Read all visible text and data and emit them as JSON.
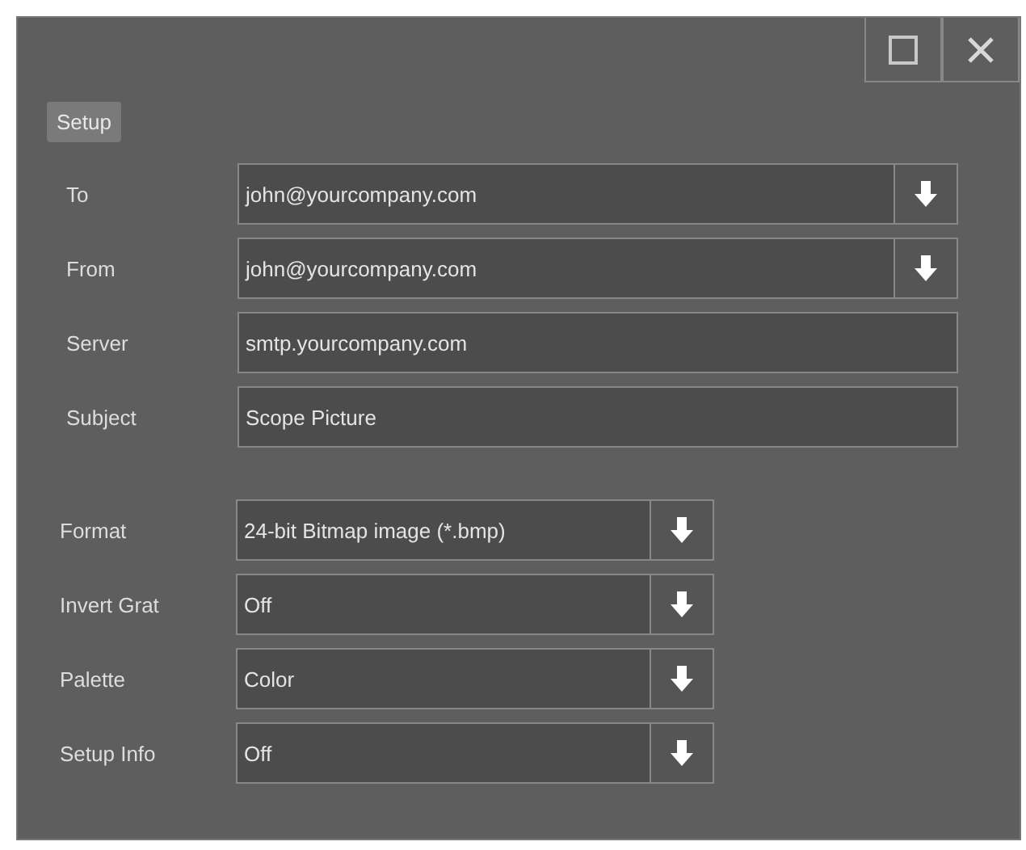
{
  "window": {
    "tab": "Setup"
  },
  "email_fields": [
    {
      "label": "To",
      "value": "john@yourcompany.com",
      "kind": "dropdown"
    },
    {
      "label": "From",
      "value": "john@yourcompany.com",
      "kind": "dropdown"
    },
    {
      "label": "Server",
      "value": "smtp.yourcompany.com",
      "kind": "text"
    },
    {
      "label": "Subject",
      "value": "Scope Picture",
      "kind": "text"
    }
  ],
  "image_fields": [
    {
      "label": "Format",
      "value": "24-bit Bitmap image (*.bmp)",
      "kind": "dropdown"
    },
    {
      "label": "Invert Grat",
      "value": "Off",
      "kind": "dropdown"
    },
    {
      "label": "Palette",
      "value": "Color",
      "kind": "dropdown"
    },
    {
      "label": "Setup Info",
      "value": "Off",
      "kind": "dropdown"
    }
  ]
}
